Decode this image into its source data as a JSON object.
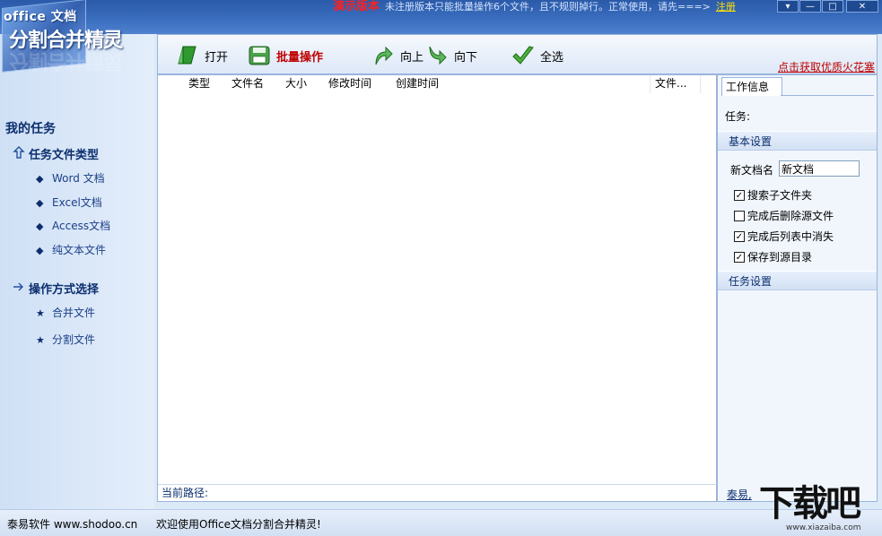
{
  "topbar": {
    "demo_label": "演示版本",
    "notice": "未注册版本只能批量操作6个文件，且不规则掉行。正常使用，请先===>",
    "register_link": "注册",
    "menu_glyph": "▾",
    "minimize_glyph": "—",
    "maximize_glyph": "□",
    "close_glyph": "✕"
  },
  "logo": {
    "line1": "office 文档",
    "line2": "分割合并精灵"
  },
  "sidebar": {
    "title": "我的任务",
    "groups": [
      {
        "label": "任务文件类型",
        "icon": "arrow-up-icon",
        "items": [
          {
            "label": "Word 文档",
            "icon": "diamond-bullet-icon"
          },
          {
            "label": "Excel文档",
            "icon": "diamond-bullet-icon"
          },
          {
            "label": "Access文档",
            "icon": "diamond-bullet-icon"
          },
          {
            "label": "纯文本文件",
            "icon": "diamond-bullet-icon"
          }
        ]
      },
      {
        "label": "操作方式选择",
        "icon": "arrow-right-icon",
        "items": [
          {
            "label": "合并文件",
            "icon": "star-bullet-icon"
          },
          {
            "label": "分割文件",
            "icon": "star-bullet-icon"
          }
        ]
      }
    ]
  },
  "toolbar": {
    "open": "打开",
    "batch": "批量操作",
    "up": "向上",
    "down": "向下",
    "select_all": "全选",
    "promo_link": "点击获取优质火花塞",
    "accent_red": "#c00000"
  },
  "filelist": {
    "columns": [
      "类型",
      "文件名",
      "大小",
      "修改时间",
      "创建时间",
      "文件..."
    ],
    "rows": [],
    "path_label": "当前路径:"
  },
  "rightpanel": {
    "tab_label": "工作信息",
    "task_label": "任务:",
    "basic_settings": "基本设置",
    "new_doc_label": "新文档名",
    "new_doc_value": "新文档",
    "checkboxes": [
      {
        "label": "搜索子文件夹",
        "checked": true
      },
      {
        "label": "完成后删除源文件",
        "checked": false
      },
      {
        "label": "完成后列表中消失",
        "checked": true
      },
      {
        "label": "保存到源目录",
        "checked": true
      }
    ],
    "task_settings": "任务设置",
    "footer_link": "泰易,"
  },
  "statusbar": {
    "left": "泰易软件 www.shodoo.cn",
    "message": "欢迎使用Office文档分割合并精灵!"
  },
  "watermark": {
    "text": "下载吧",
    "url": "www.xiazaiba.com"
  }
}
